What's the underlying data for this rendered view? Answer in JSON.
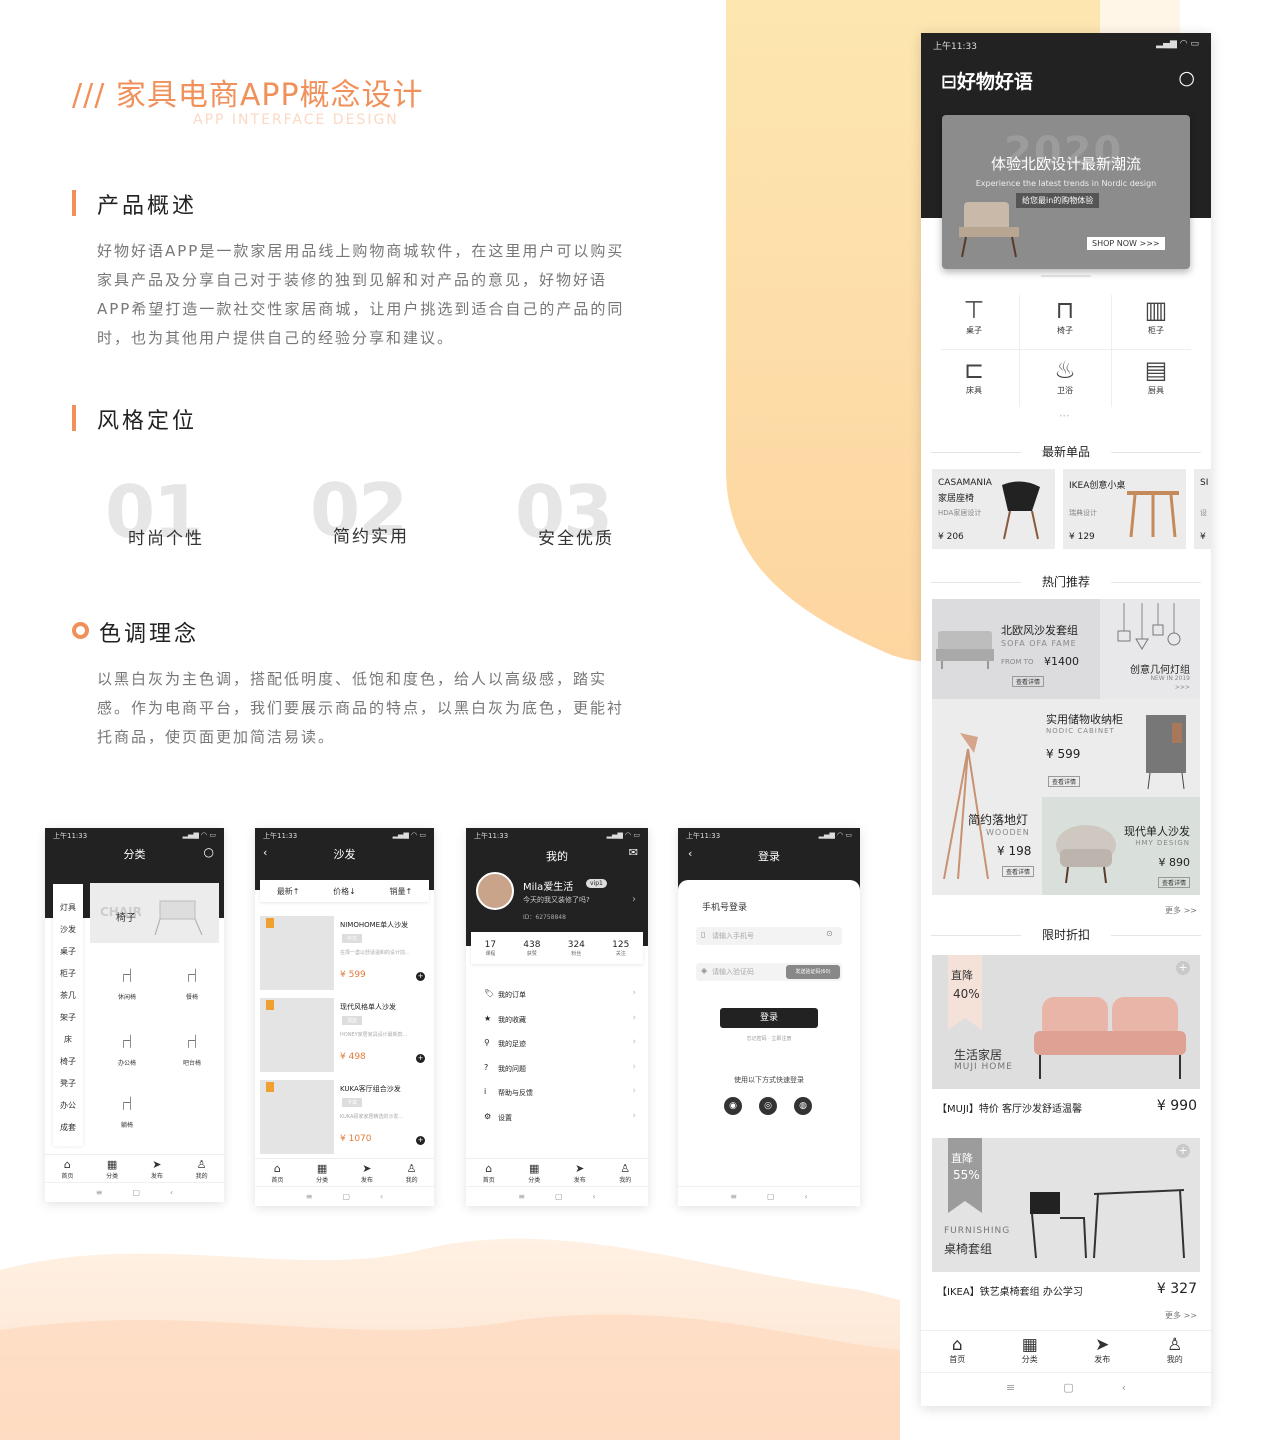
{
  "header": {
    "title": "/// 家具电商APP概念设计",
    "subtitle": "APP INTERFACE DESIGN"
  },
  "overview": {
    "heading": "产品概述",
    "text": "好物好语APP是一款家居用品线上购物商城软件，在这里用户可以购买家具产品及分享自己对于装修的独到见解和对产品的意见，好物好语APP希望打造一款社交性家居商城，让用户挑选到适合自己的产品的同时，也为其他用户提供自己的经验分享和建议。"
  },
  "style": {
    "heading": "风格定位",
    "items": [
      {
        "num": "01",
        "label": "时尚个性"
      },
      {
        "num": "02",
        "label": "简约实用"
      },
      {
        "num": "03",
        "label": "安全优质"
      }
    ]
  },
  "color": {
    "heading": "色调理念",
    "text": "以黑白灰为主色调，搭配低明度、低饱和度色，给人以高级感，踏实感。作为电商平台，我们要展示商品的特点，以黑白灰为底色，更能衬托商品，使页面更加简洁易读。"
  },
  "common": {
    "time": "上午11:33",
    "signal": "▂▄▆ ◠ ▭",
    "tabs": [
      "首页",
      "分类",
      "发布",
      "我的"
    ],
    "nav": [
      "≡",
      "▢",
      "‹"
    ]
  },
  "p1": {
    "title": "分类",
    "side": [
      "灯具",
      "沙发",
      "桌子",
      "柜子",
      "茶几",
      "架子",
      "床",
      "椅子",
      "凳子",
      "办公",
      "成套"
    ],
    "banner": "椅子",
    "banner_bg": "CHAIR",
    "items": [
      "休闲椅",
      "餐椅",
      "办公椅",
      "吧台椅",
      "躺椅"
    ]
  },
  "p2": {
    "title": "沙发",
    "sorts": [
      "最新↑",
      "价格↓",
      "销量↑"
    ],
    "products": [
      {
        "name": "NIMOHOME单人沙发",
        "tag": "中式",
        "desc": "在择一盏以舒适温和的设计前...",
        "price": "¥ 599"
      },
      {
        "name": "现代风格单人沙发",
        "tag": "浅蓝",
        "desc": "HONEY家居家具设计最新款...",
        "price": "¥ 498"
      },
      {
        "name": "KUKA客厅组合沙发",
        "tag": "卡其",
        "desc": "KUKA顾家家居精选的沙发...",
        "price": "¥ 1070"
      }
    ]
  },
  "p3": {
    "title": "我的",
    "user": "Mila爱生活",
    "vip": "vip1",
    "motto": "今天的我又装修了吗?",
    "id": "ID：62758848",
    "stats": [
      {
        "n": "17",
        "l": "课程"
      },
      {
        "n": "438",
        "l": "获赞"
      },
      {
        "n": "324",
        "l": "粉丝"
      },
      {
        "n": "125",
        "l": "关注"
      }
    ],
    "menu": [
      "我的订单",
      "我的收藏",
      "我的足迹",
      "我的问题",
      "帮助与反馈",
      "设置"
    ]
  },
  "p4": {
    "title": "登录",
    "method": "手机号登录",
    "phone_ph": "请输入手机号",
    "code_ph": "请输入验证码",
    "send": "发送验证码(60)",
    "btn": "登录",
    "links": "忘记密码 · 立即注册",
    "quick": "使用以下方式快速登录"
  },
  "big": {
    "brand": "好物好语",
    "banner": {
      "year": "2020",
      "title": "体验北欧设计最新潮流",
      "en": "Experience the latest trends in Nordic design",
      "cn": "给您最in的购物体验",
      "btn": "SHOP NOW >>>"
    },
    "cats": [
      "桌子",
      "椅子",
      "柜子",
      "床具",
      "卫浴",
      "厨具"
    ],
    "new_title": "最新单品",
    "new": [
      {
        "brand": "CASAMANIA",
        "name": "家居座椅",
        "sub": "HDA家居设计",
        "price": "¥ 206"
      },
      {
        "brand": "IKEA创意小桌",
        "name": "",
        "sub": "瑞典设计",
        "price": "¥ 129"
      },
      {
        "brand": "SI",
        "name": "",
        "sub": "设",
        "price": "¥"
      }
    ],
    "hot_title": "热门推荐",
    "hot": {
      "sofa": "北欧风沙发套组",
      "sofa_en": "SOFA OFA FAME",
      "sofa_from": "FROM TO",
      "sofa_price": "¥1400",
      "detail": "查看详情",
      "lamp2": "创意几何灯组",
      "lamp2_en": "NEW IN 2019",
      "lamp2_more": ">>>",
      "cabinet": "实用储物收纳柜",
      "cabinet_en": "NODIC CABINET",
      "cabinet_price": "¥ 599",
      "floor": "简约落地灯",
      "floor_en": "WOODEN",
      "floor_price": "¥ 198",
      "armchair": "现代单人沙发",
      "armchair_en": "HMY DESIGN",
      "armchair_price": "¥ 890"
    },
    "more": "更多 >>",
    "sale_title": "限时折扣",
    "sale": [
      {
        "drop": "直降",
        "pct": "40%",
        "cn": "生活家居",
        "en": "MUJI HOME",
        "desc": "【MUJI】特价 客厅沙发舒适温馨",
        "price": "¥ 990"
      },
      {
        "drop": "直降",
        "pct": "55%",
        "en": "FURNISHING",
        "cn": "桌椅套组",
        "desc": "【IKEA】铁艺桌椅套组 办公学习",
        "price": "¥ 327"
      }
    ]
  }
}
